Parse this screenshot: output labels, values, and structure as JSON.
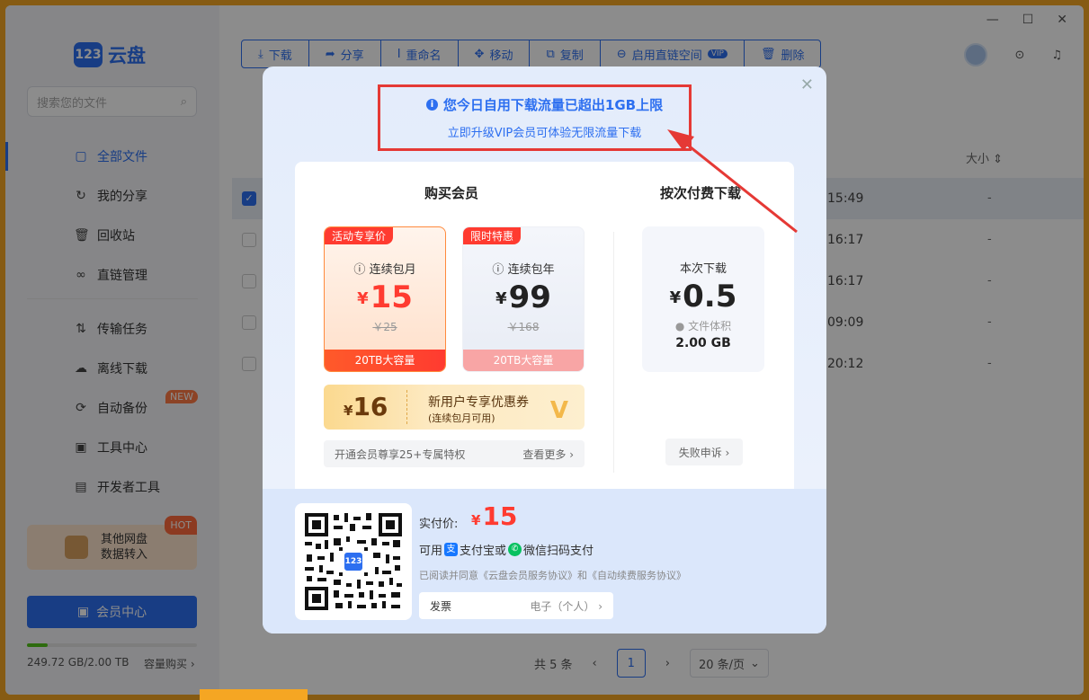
{
  "app": {
    "logo_badge": "123",
    "logo_text": "云盘"
  },
  "window_controls": {
    "minimize": "—",
    "maximize": "☐",
    "close": "✕"
  },
  "sidebar": {
    "search_placeholder": "搜索您的文件",
    "items": [
      {
        "label": "全部文件",
        "icon": "folder-icon",
        "glyph": "▢",
        "active": true
      },
      {
        "label": "我的分享",
        "icon": "share-icon",
        "glyph": "↻"
      },
      {
        "label": "回收站",
        "icon": "trash-icon",
        "glyph": "🗑"
      },
      {
        "label": "直链管理",
        "icon": "link-icon",
        "glyph": "∞"
      },
      {
        "label": "传输任务",
        "icon": "transfer-icon",
        "glyph": "⇅"
      },
      {
        "label": "离线下载",
        "icon": "cloud-download-icon",
        "glyph": "☁"
      },
      {
        "label": "自动备份",
        "icon": "backup-icon",
        "glyph": "⟳",
        "badge": "NEW"
      },
      {
        "label": "工具中心",
        "icon": "toolbox-icon",
        "glyph": "▣"
      },
      {
        "label": "开发者工具",
        "icon": "terminal-icon",
        "glyph": "▤"
      }
    ],
    "promo": {
      "line1": "其他网盘",
      "line2": "数据转入",
      "badge": "HOT"
    },
    "member_button": "会员中心",
    "storage": {
      "text": "249.72 GB/2.00 TB",
      "buy": "容量购买 ›",
      "used_fraction": 0.12
    }
  },
  "toolbar": {
    "buttons": [
      {
        "label": "下载",
        "icon": "download-icon",
        "glyph": "⤓"
      },
      {
        "label": "分享",
        "icon": "share-arrow-icon",
        "glyph": "➦"
      },
      {
        "label": "重命名",
        "icon": "rename-icon",
        "glyph": "Ⅰ"
      },
      {
        "label": "移动",
        "icon": "move-icon",
        "glyph": "✥"
      },
      {
        "label": "复制",
        "icon": "copy-icon",
        "glyph": "⧉"
      },
      {
        "label": "启用直链空间",
        "icon": "direct-link-icon",
        "glyph": "⊖",
        "tag": "VIP"
      },
      {
        "label": "删除",
        "icon": "delete-icon",
        "glyph": "🗑"
      }
    ]
  },
  "list": {
    "size_header": "大小 ⇕",
    "rows": [
      {
        "time": "15:49",
        "size": "-",
        "selected": true
      },
      {
        "time": "16:17",
        "size": "-"
      },
      {
        "time": "16:17",
        "size": "-"
      },
      {
        "time": "09:09",
        "size": "-"
      },
      {
        "time": "20:12",
        "size": "-"
      }
    ]
  },
  "pager": {
    "total": "共 5 条",
    "prev": "‹",
    "current": "1",
    "next": "›",
    "page_size": "20 条/页"
  },
  "modal": {
    "close": "✕",
    "title": "您今日自用下载流量已超出1GB上限",
    "subtitle": "立即升级VIP会员可体验无限流量下载",
    "buy_title": "购买会员",
    "per_title": "按次付费下载",
    "monthly": {
      "tag": "活动专享价",
      "name": "连续包月",
      "price": "15",
      "orig": "￥25",
      "foot": "20TB大容量"
    },
    "yearly": {
      "tag": "限时特惠",
      "name": "连续包年",
      "price": "99",
      "orig": "￥168",
      "foot": "20TB大容量"
    },
    "coupon": {
      "amount": "16",
      "title": "新用户专享优惠券",
      "note": "(连续包月可用)"
    },
    "perks": {
      "text": "开通会员尊享25+专属特权",
      "more": "查看更多 ›"
    },
    "per_download": {
      "name": "本次下载",
      "price": "0.5",
      "vol_label": "文件体积",
      "vol": "2.00 GB"
    },
    "appeal": "失败申诉 ›",
    "payment": {
      "price_label": "实付价:",
      "price": "15",
      "methods_prefix": "可用",
      "alipay": "支付宝或",
      "wechat": "微信扫码支付",
      "agree": "已阅读并同意《云盘会员服务协议》和《自动续费服务协议》",
      "invoice_label": "发票",
      "invoice_value": "电子（个人） ›",
      "qr_badge": "123"
    }
  },
  "colors": {
    "accent": "#2d6ff0",
    "price_red": "#ff3b30",
    "annotation": "#e53935"
  }
}
